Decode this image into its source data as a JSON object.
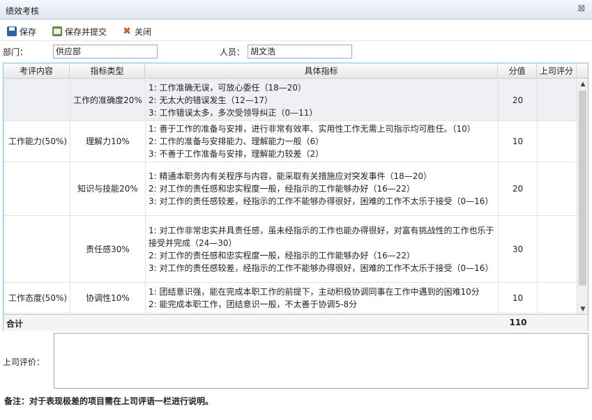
{
  "window": {
    "title": "绩效考核",
    "close_icon": "close-icon"
  },
  "toolbar": {
    "save_label": "保存",
    "save_submit_label": "保存并提交",
    "close_label": "关闭"
  },
  "form": {
    "department_label": "部门：",
    "department_value": "供应部",
    "person_label": "人员：",
    "person_value": "胡文浩"
  },
  "grid": {
    "columns": [
      "考评内容",
      "指标类型",
      "具体指标",
      "分值",
      "上司评分"
    ],
    "rows": [
      {
        "category": "",
        "type": "工作的准确度20%",
        "details": [
          "1:  工作准确无误，可放心委任（18—20）",
          "2:  无太大的错误发生（12—17）",
          "3:  工作错误太多，多次受领导纠正（0—11）"
        ],
        "score": "20",
        "boss": ""
      },
      {
        "category": "工作能力(50%)",
        "type": "理解力10%",
        "details": [
          "1:  善于工作的准备与安排，进行非常有效率、实用性工作无需上司指示均可胜任。（10）",
          "2:  工作的准备与安排能力、理解能力一般（6）",
          "3:  不善于工作准备与安排，理解能力较差（2）"
        ],
        "score": "10",
        "boss": ""
      },
      {
        "category": "",
        "type": "知识与技能20%",
        "details": [
          "1:  精通本职务内有关程序与内容，能采取有关措施应对突发事件（18—20）",
          "2:  对工作的责任感和忠实程度一般，经指示的工作能够办好（16—22）",
          "3:  对工作的责任感较差，经指示的工作不能够办得很好，困难的工作不太乐于接受（0—16）"
        ],
        "score": "20",
        "boss": ""
      },
      {
        "category": "",
        "type": "责任感30%",
        "details": [
          "1:  对工作非常忠实并具责任感，虽未经指示的工作也能办得很好，对富有挑战性的工作也乐于接受并完成（24—30）",
          "2:  对工作的责任感和忠实程度一般，经指示的工作能够办好（16—22）",
          "3:  对工作的责任感较差，经指示的工作不能够办得很好，困难的工作不太乐于接受（0—16）"
        ],
        "score": "30",
        "boss": ""
      },
      {
        "category": "工作态度(50%)",
        "type": "协调性10%",
        "details": [
          "1:  团结意识强，能在完成本职工作的前提下，主动积极协调同事在工作中遇到的困难10分",
          "2:  能完成本职工作，团结意识一般，不太善于协调5-8分"
        ],
        "score": "10",
        "boss": ""
      }
    ],
    "footer_label": "合计",
    "footer_total": "110"
  },
  "comment": {
    "label": "上司评价：",
    "value": ""
  },
  "note": "备注：对于表现极差的项目需在上司评语一栏进行说明。"
}
